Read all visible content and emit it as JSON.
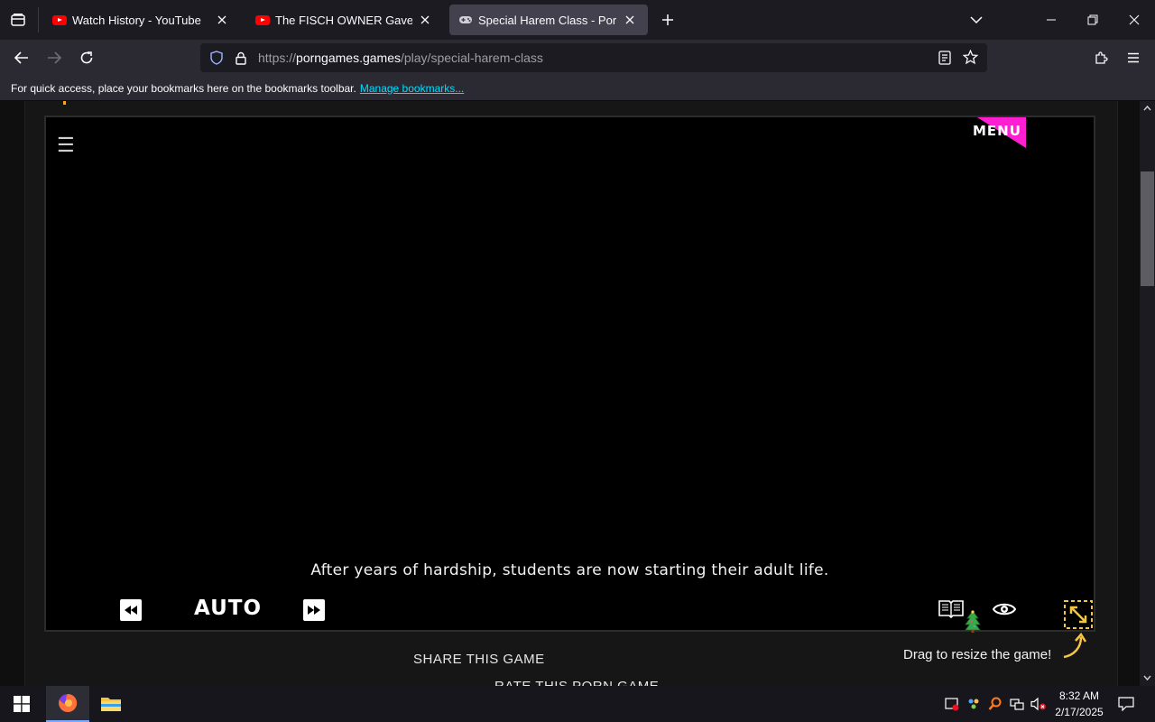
{
  "browser": {
    "tabs": [
      {
        "title": "Watch History - YouTube",
        "favicon": "youtube-icon",
        "active": false
      },
      {
        "title": "The FISCH OWNER Gave Me AD",
        "favicon": "youtube-icon",
        "active": false
      },
      {
        "title": "Special Harem Class - Porn Gan",
        "favicon": "gamepad-icon",
        "active": true
      }
    ],
    "url": {
      "scheme": "https://",
      "host": "porngames.games",
      "path": "/play/special-harem-class"
    },
    "bookmarks_bar": {
      "message": "For quick access, place your bookmarks here on the bookmarks toolbar.",
      "link": "Manage bookmarks..."
    }
  },
  "game": {
    "menu_label": "MENU",
    "dialogue": "After years of hardship, students are now starting their adult life.",
    "auto_label": "AUTO",
    "accent_color": "#ff1fd2",
    "resize_color": "#f5c542"
  },
  "page": {
    "share_label": "SHARE THIS GAME",
    "rate_label": "RATE THIS PORN GAME",
    "drag_hint": "Drag to resize the game!"
  },
  "taskbar": {
    "time": "8:32 AM",
    "date": "2/17/2025"
  }
}
